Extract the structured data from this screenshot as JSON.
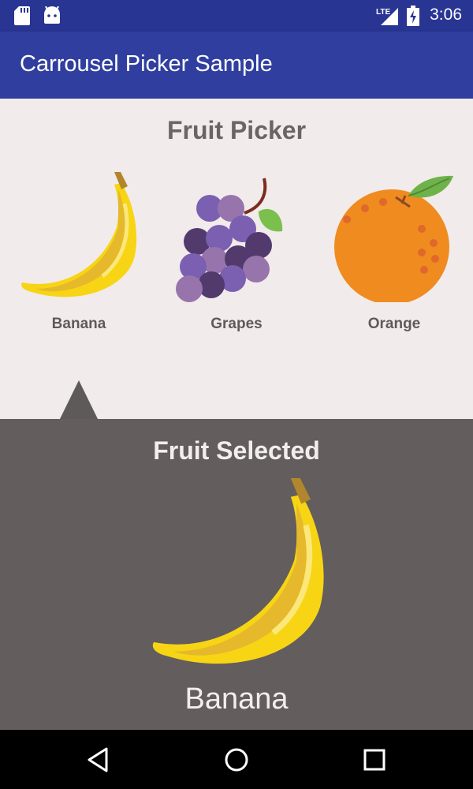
{
  "status_bar": {
    "time": "3:06",
    "network": "LTE",
    "icons": [
      "sd-card-icon",
      "android-icon",
      "lte-signal-icon",
      "battery-charging-icon"
    ]
  },
  "app_bar": {
    "title": "Carrousel Picker Sample"
  },
  "picker": {
    "heading": "Fruit Picker",
    "items": [
      {
        "label": "Banana",
        "icon": "banana-icon"
      },
      {
        "label": "Grapes",
        "icon": "grapes-icon"
      },
      {
        "label": "Orange",
        "icon": "orange-icon"
      }
    ],
    "selected_index": 0
  },
  "selection": {
    "heading": "Fruit Selected",
    "fruit_name": "Banana",
    "icon": "banana-icon"
  },
  "nav_bar": {
    "buttons": [
      "back-icon",
      "home-icon",
      "recents-icon"
    ]
  },
  "colors": {
    "status_bar": "#283593",
    "app_bar": "#303f9f",
    "picker_bg": "#f1ebec",
    "selected_bg": "#635d5d",
    "banana": "#f7d514",
    "grapes": "#7b5fb0",
    "orange": "#ef8b1f"
  }
}
